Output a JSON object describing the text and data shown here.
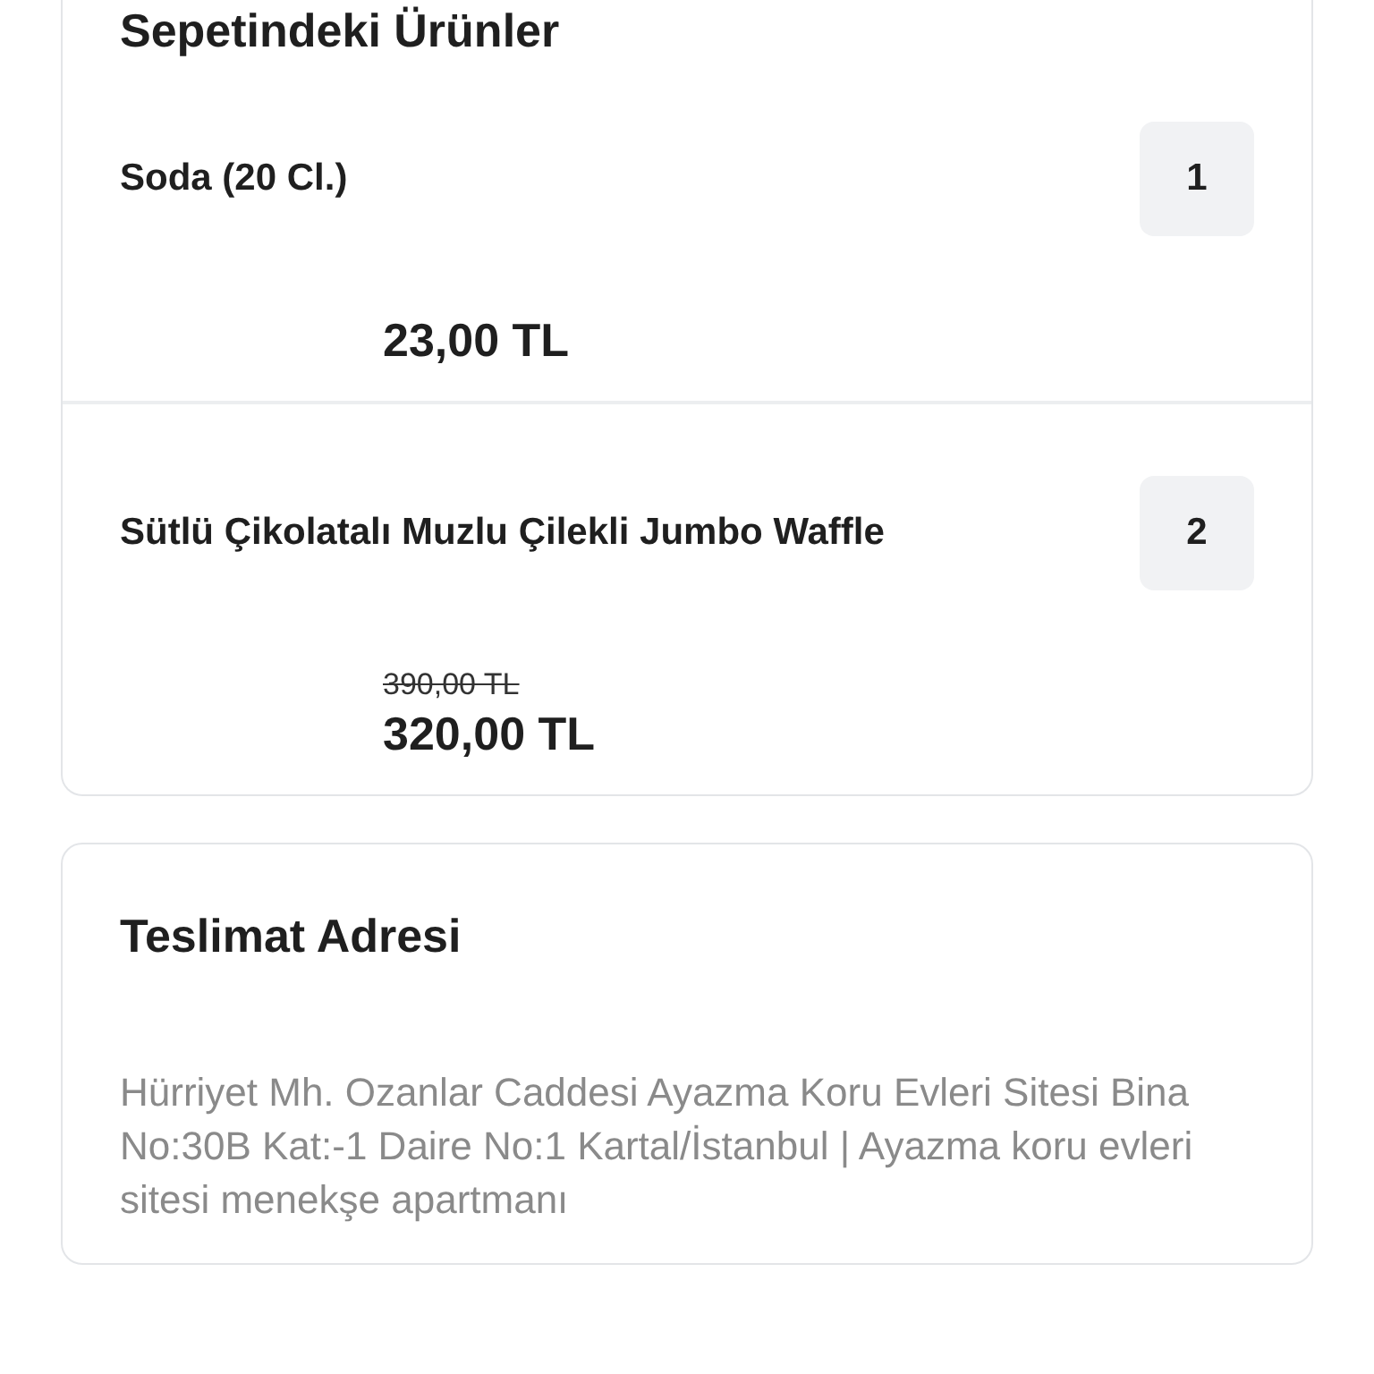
{
  "cart": {
    "title": "Sepetindeki Ürünler",
    "items": [
      {
        "name": "Soda (20 Cl.)",
        "quantity": "1",
        "price": "23,00 TL"
      },
      {
        "name": "Sütlü Çikolatalı Muzlu Çilekli Jumbo Waffle",
        "quantity": "2",
        "old_price": "390,00 TL",
        "price": "320,00 TL"
      }
    ]
  },
  "delivery": {
    "title": "Teslimat Adresi",
    "address": "Hürriyet Mh. Ozanlar Caddesi Ayazma Koru Evleri Sitesi Bina No:30B Kat:-1 Daire No:1 Kartal/İstanbul | Ayazma koru evleri sitesi menekşe apartmanı"
  }
}
